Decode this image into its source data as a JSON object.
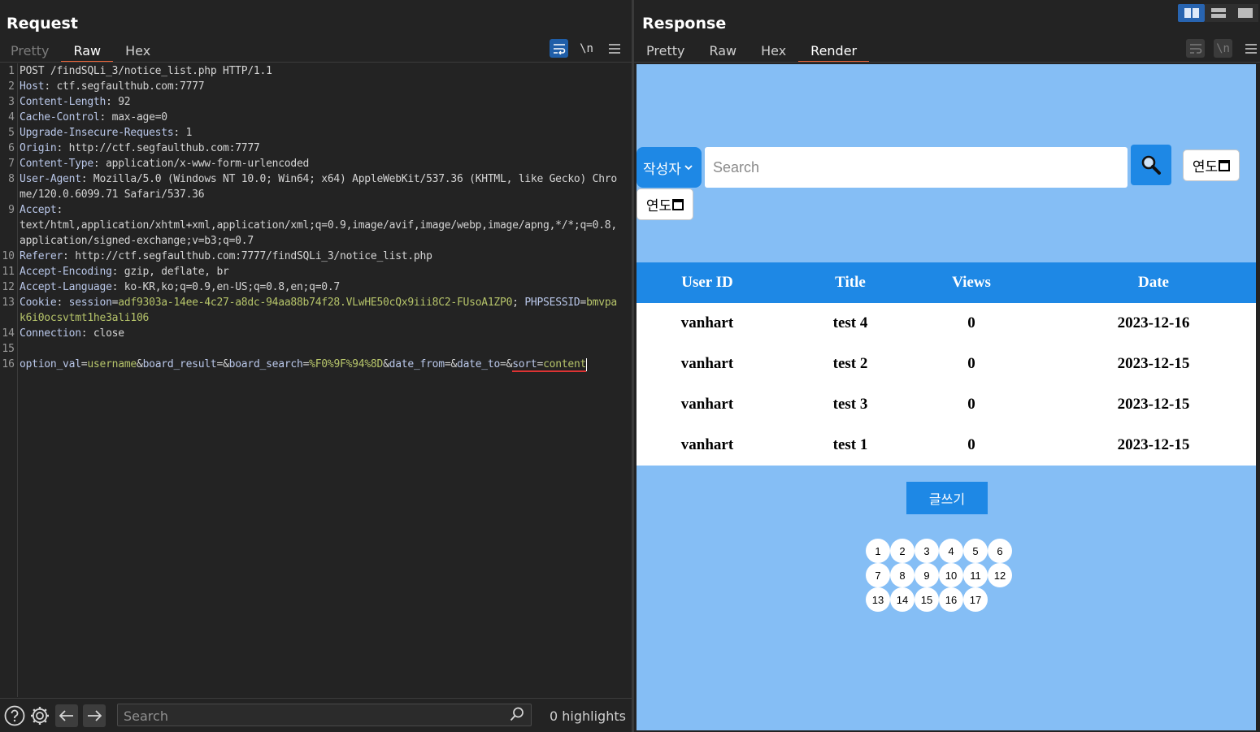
{
  "request": {
    "title": "Request",
    "tabs": [
      "Pretty",
      "Raw",
      "Hex"
    ],
    "active_tab": "Raw",
    "tool_icons": [
      "wrap-icon",
      "newline-icon",
      "menu-icon"
    ],
    "newline_label": "\\n",
    "lines": [
      {
        "n": "1",
        "text": "POST /findSQLi_3/notice_list.php HTTP/1.1"
      },
      {
        "n": "2",
        "key": "Host",
        "val": "ctf.segfaulthub.com:7777"
      },
      {
        "n": "3",
        "key": "Content-Length",
        "val": "92"
      },
      {
        "n": "4",
        "key": "Cache-Control",
        "val": "max-age=0"
      },
      {
        "n": "5",
        "key": "Upgrade-Insecure-Requests",
        "val": "1"
      },
      {
        "n": "6",
        "key": "Origin",
        "val": "http://ctf.segfaulthub.com:7777"
      },
      {
        "n": "7",
        "key": "Content-Type",
        "val": "application/x-www-form-urlencoded"
      },
      {
        "n": "8",
        "key": "User-Agent",
        "val": "Mozilla/5.0 (Windows NT 10.0; Win64; x64) AppleWebKit/537.36 (KHTML, like Gecko) Chrome/120.0.6099.71 Safari/537.36"
      },
      {
        "n": "9",
        "key": "Accept",
        "val": "text/html,application/xhtml+xml,application/xml;q=0.9,image/avif,image/webp,image/apng,*/*;q=0.8,application/signed-exchange;v=b3;q=0.7"
      },
      {
        "n": "10",
        "key": "Referer",
        "val": "http://ctf.segfaulthub.com:7777/findSQLi_3/notice_list.php"
      },
      {
        "n": "11",
        "key": "Accept-Encoding",
        "val": "gzip, deflate, br"
      },
      {
        "n": "12",
        "key": "Accept-Language",
        "val": "ko-KR,ko;q=0.9,en-US;q=0.8,en;q=0.7"
      },
      {
        "n": "13",
        "key": "Cookie",
        "cookie": [
          {
            "k": "session",
            "v": "adf9303a-14ee-4c27-a8dc-94aa88b74f28.VLwHE50cQx9iii8C2-FUsoA1ZP0"
          },
          {
            "k": "PHPSESSID",
            "v": "bmvpak6i0ocsvtmt1he3ali106"
          }
        ]
      },
      {
        "n": "14",
        "key": "Connection",
        "val": "close"
      },
      {
        "n": "15",
        "text": ""
      },
      {
        "n": "16",
        "params": [
          {
            "k": "option_val",
            "v": "username"
          },
          {
            "k": "board_result",
            "v": ""
          },
          {
            "k": "board_search",
            "v": "%F0%9F%94%8D"
          },
          {
            "k": "date_from",
            "v": ""
          },
          {
            "k": "date_to",
            "v": ""
          },
          {
            "k": "sort",
            "v": "content"
          }
        ]
      }
    ],
    "search_placeholder": "Search",
    "highlights": "0 highlights"
  },
  "response": {
    "title": "Response",
    "tabs": [
      "Pretty",
      "Raw",
      "Hex",
      "Render"
    ],
    "active_tab": "Render",
    "render": {
      "select_label": "작성자",
      "search_placeholder": "Search",
      "date_label": "연도",
      "table": {
        "headers": [
          "User ID",
          "Title",
          "Views",
          "Date"
        ],
        "rows": [
          [
            "vanhart",
            "test 4",
            "0",
            "2023-12-16"
          ],
          [
            "vanhart",
            "test 2",
            "0",
            "2023-12-15"
          ],
          [
            "vanhart",
            "test 3",
            "0",
            "2023-12-15"
          ],
          [
            "vanhart",
            "test 1",
            "0",
            "2023-12-15"
          ]
        ]
      },
      "write_button": "글쓰기",
      "pages": [
        "1",
        "2",
        "3",
        "4",
        "5",
        "6",
        "7",
        "8",
        "9",
        "10",
        "11",
        "12",
        "13",
        "14",
        "15",
        "16",
        "17"
      ]
    }
  },
  "layout_toggles": [
    "side-by-side",
    "stacked",
    "single"
  ],
  "colors": {
    "accent": "#e8643a",
    "render_bg": "#85bef5",
    "primary_blue": "#1e88e5",
    "panel_bg": "#232323"
  }
}
